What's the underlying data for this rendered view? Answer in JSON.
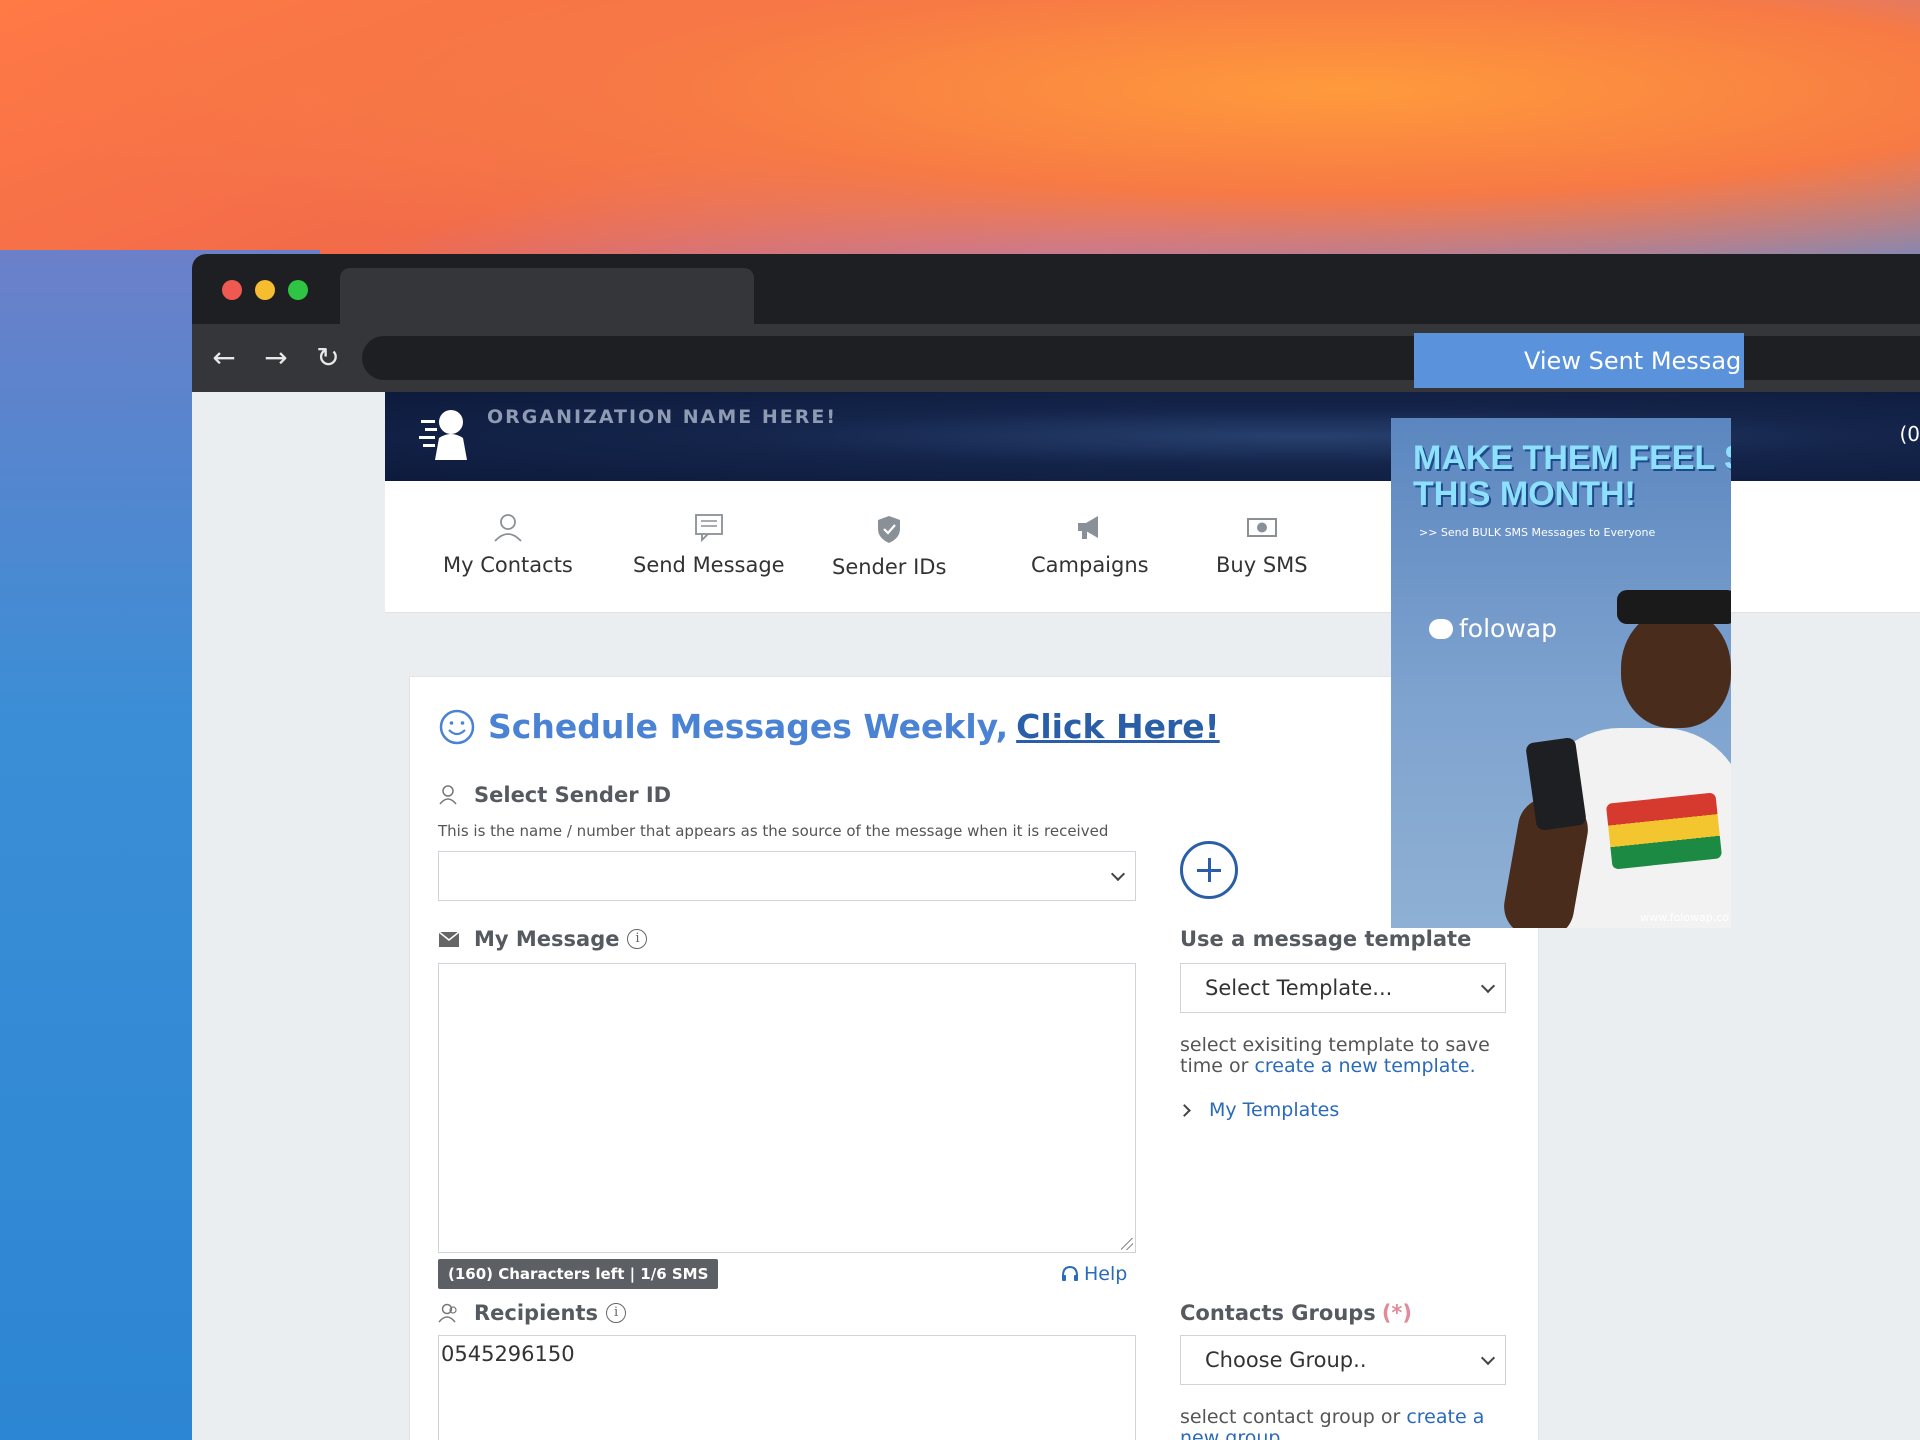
{
  "banner": {
    "org_name": "ORGANIZATION NAME HERE!",
    "edge_text": "(0"
  },
  "nav": {
    "items": [
      {
        "label": "My Contacts",
        "icon": "user-icon"
      },
      {
        "label": "Send Message",
        "icon": "message-icon"
      },
      {
        "label": "Sender IDs",
        "icon": "shield-icon"
      },
      {
        "label": "Campaigns",
        "icon": "megaphone-icon"
      },
      {
        "label": "Buy SMS",
        "icon": "money-icon"
      }
    ]
  },
  "promo": {
    "text": "Schedule Messages Weekly,",
    "link": "Click Here!"
  },
  "sender": {
    "label": "Select Sender ID",
    "hint": "This is the name / number that appears as the source of the message when it is received",
    "value": ""
  },
  "message": {
    "label": "My Message",
    "info": "i",
    "value": "",
    "counter": "(160) Characters left  |  1/6 SMS",
    "help": "Help"
  },
  "template": {
    "label": "Use a message template",
    "select_value": "Select Template...",
    "hint_prefix": "select exisiting template to save time or ",
    "hint_link": "create a new template.",
    "my_templates": "My Templates"
  },
  "recipients": {
    "label": "Recipients",
    "info": "i",
    "value": "0545296150"
  },
  "groups": {
    "label": "Contacts Groups",
    "required": "(*)",
    "select_value": "Choose Group..",
    "hint_prefix": "select contact group or ",
    "hint_link": "create a new group."
  },
  "sidebar": {
    "view_sent": "View Sent Messag"
  },
  "ad": {
    "title_line1": "MAKE THEM FEEL SPEC",
    "title_line2": "THIS MONTH!",
    "subtitle": ">> Send BULK SMS Messages to Everyone",
    "brand": "folowap",
    "url": "www.folowap.co"
  },
  "colors": {
    "accent": "#4a82d4",
    "link": "#2a6aba",
    "button": "#5b92dc",
    "banner": "#14244a"
  }
}
